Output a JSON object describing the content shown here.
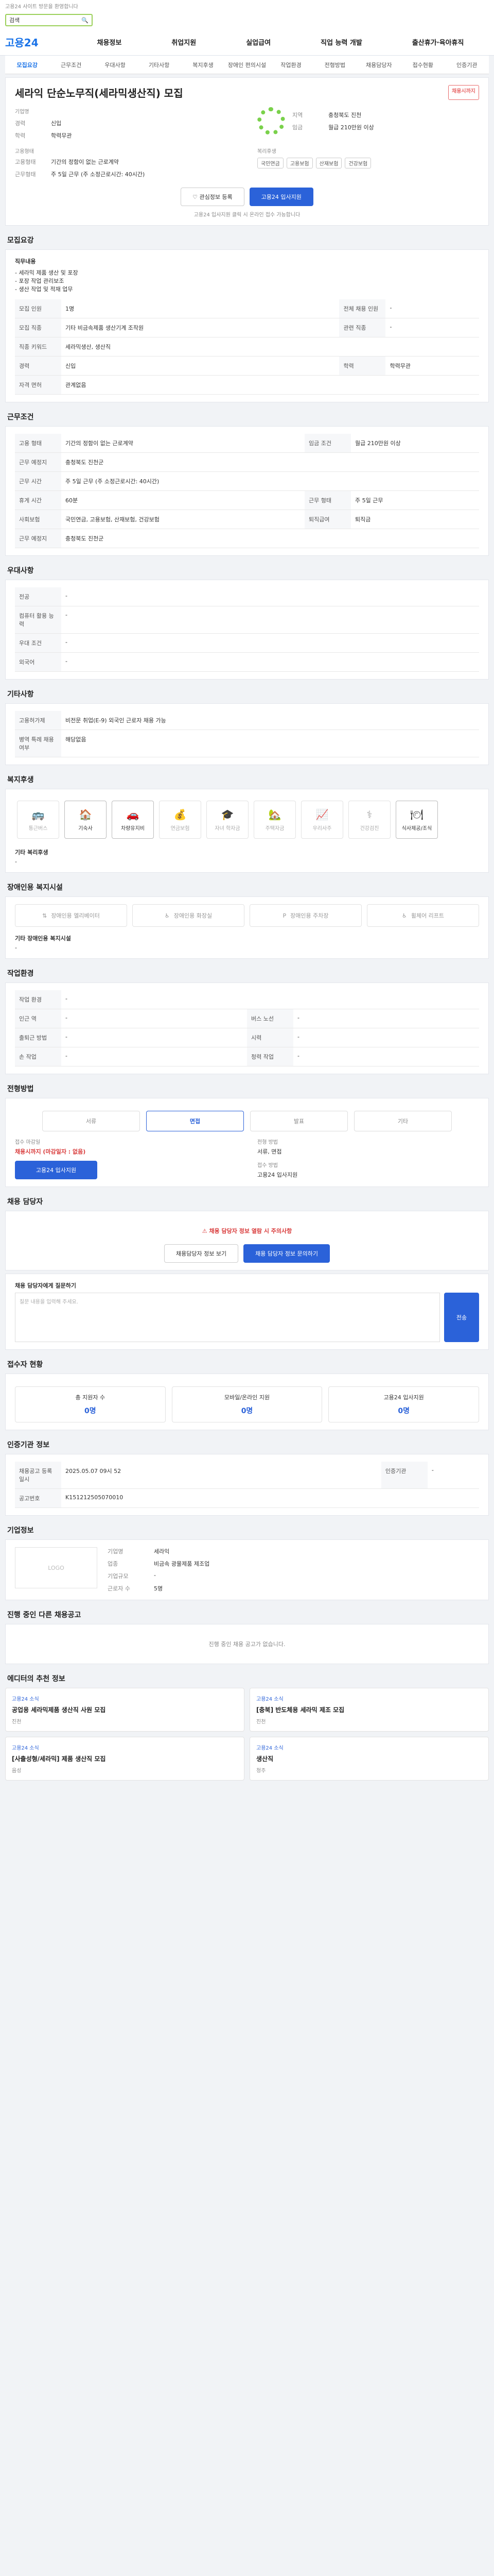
{
  "top_note": "고용24 사이트 방문을 환영합니다",
  "search": {
    "value": "검색"
  },
  "logo": "고용24",
  "gnb": [
    "채용정보",
    "취업지원",
    "실업급여",
    "직업 능력 개발",
    "출산휴가·육아휴직"
  ],
  "tabs": [
    "모집요강",
    "근무조건",
    "우대사항",
    "기타사항",
    "복지후생",
    "장애인 편의시설",
    "작업환경",
    "전형방법",
    "채용담당자",
    "접수현황",
    "인증기관"
  ],
  "job": {
    "company_label": "기업명",
    "title": "세라익 단순노무직(세라믹생산직) 모집",
    "badge": "채용시까지",
    "fields": [
      {
        "k": "경력",
        "v": "신입"
      },
      {
        "k": "학력",
        "v": "학력무관"
      }
    ],
    "fields2": [
      {
        "k": "지역",
        "v": "충청북도 진천"
      },
      {
        "k": "임금",
        "v": "월급 210만원 이상"
      }
    ],
    "cond_label": "고용형태",
    "cond": [
      {
        "k": "고용형태",
        "v": "기간의 정함이 없는 근로계약"
      },
      {
        "k": "근무형태",
        "v": "주 5일 근무 (주 소정근로시간: 40시간)"
      }
    ],
    "benefit_label": "복리후생",
    "benefits": [
      "국민연금",
      "고용보험",
      "산재보험",
      "건강보험"
    ]
  },
  "buttons": {
    "scrap": "관심정보 등록",
    "apply": "고용24 입사지원"
  },
  "apply_note": "고용24 입사지원 클릭 시 온라인 접수 가능합니다",
  "sections": {
    "recruit": "모집요강",
    "work": "근무조건",
    "pref": "우대사항",
    "etc": "기타사항",
    "welfare": "복지후생",
    "disabled": "장애인용 복지시설",
    "env": "작업환경",
    "screen": "전형방법",
    "manager": "채용 담당자",
    "status": "접수자 현황",
    "cert": "인증기관 정보",
    "company": "기업정보",
    "other": "진행 중인 다른 채용공고",
    "recommend": "에디터의 추천 정보"
  },
  "recruit_duty": "직무내용",
  "recruit_duties": [
    "- 세라믹 제품 생산 및 포장",
    "- 포장 작업 관리보조",
    "- 생산 작업 및 적재 업무"
  ],
  "recruit_rows": [
    [
      "모집 인원",
      "1명",
      "전체 채용 인원",
      "-"
    ],
    [
      "모집 직종",
      "기타 비금속제품 생산기계 조작원",
      "관련 직종",
      "-"
    ],
    [
      "직종 키워드",
      "세라믹생산, 생산직",
      "",
      ""
    ],
    [
      "경력",
      "신입",
      "학력",
      "학력무관"
    ],
    [
      "자격 면허",
      "관계없음",
      "",
      ""
    ]
  ],
  "work_rows": [
    [
      "고용 형태",
      "기간의 정함이 없는 근로계약",
      "임금 조건",
      "월급 210만원 이상"
    ],
    [
      "근무 예정지",
      "충청북도 진천군",
      "",
      ""
    ],
    [
      "근무 시간",
      "주 5일 근무 (주 소정근로시간: 40시간)",
      "",
      ""
    ],
    [
      "휴게 시간",
      "60분",
      "근무 형태",
      "주 5일 근무"
    ],
    [
      "사회보험",
      "국민연금, 고용보험, 산재보험, 건강보험",
      "퇴직급여",
      "퇴직금"
    ],
    [
      "근무 예정지",
      "충청북도 진천군",
      "",
      ""
    ]
  ],
  "pref_rows": [
    [
      "전공",
      "-"
    ],
    [
      "컴퓨터 활용 능력",
      "-"
    ],
    [
      "우대 조건",
      "-"
    ],
    [
      "외국어",
      "-"
    ]
  ],
  "etc_rows": [
    [
      "고용허가제",
      "비전문 취업(E-9) 외국인 근로자 채용 가능"
    ],
    [
      "병역 특례 채용 여부",
      "해당없음"
    ]
  ],
  "welfare_items": [
    "통근버스",
    "기숙사",
    "차량유지비",
    "연금보험",
    "자녀 학자금",
    "주택자금",
    "우리사주",
    "건강검진",
    "식사제공/조식"
  ],
  "welfare_etc": "기타 복리후생",
  "disabled_items": [
    "장애인용 엘리베이터",
    "장애인용 화장실",
    "장애인용 주차장",
    "휠체어 리프트"
  ],
  "disabled_etc": "기타 장애인용 복지시설",
  "env_rows": [
    [
      "작업 환경",
      "-"
    ],
    [
      "인근 역",
      "-",
      "버스 노선",
      "-"
    ],
    [
      "출퇴근 방법",
      "-",
      "시력",
      "-"
    ],
    [
      "손 작업",
      "-",
      "청력 작업",
      "-"
    ]
  ],
  "steps": [
    "서류",
    "면접",
    "발표",
    "기타"
  ],
  "screen_info": [
    {
      "k": "접수 마감일",
      "v": "채용시까지 (마감일자 : 없음)"
    },
    {
      "k": "전형 방법",
      "v": "서류, 면접"
    },
    {
      "k": "접수 방법",
      "v": "고용24 입사지원"
    }
  ],
  "screen_btn": "고용24 입사지원",
  "manager_alert": "채용 담당자 정보 열람 시 주의사항",
  "manager_btn1": "채용담당자 정보 보기",
  "manager_btn2": "채용 담당자 정보 문의하기",
  "inquiry_label": "채용 담당자에게 질문하기",
  "inquiry_placeholder": "질문 내용을 입력해 주세요.",
  "inquiry_btn": "전송",
  "stats": [
    {
      "k": "총 지원자 수",
      "v": "0명"
    },
    {
      "k": "모바일/온라인 지원",
      "v": "0명"
    },
    {
      "k": "고용24 입사지원",
      "v": "0명"
    }
  ],
  "cert_rows": [
    [
      "채용공고 등록일시",
      "2025.05.07 09시 52",
      "인증기관",
      "-"
    ],
    [
      "공고번호",
      "K151212505070010"
    ]
  ],
  "company_info": [
    [
      "기업명",
      "세라익"
    ],
    [
      "업종",
      "비금속 광물제품 제조업"
    ],
    [
      "기업규모",
      "-"
    ],
    [
      "근로자 수",
      "5명"
    ]
  ],
  "other_msg": "진행 중인 채용 공고가 없습니다.",
  "recommends": [
    {
      "cat": "고용24 소식",
      "title": "공업용 세라믹제품 생산직 사원 모집",
      "loc": "진천"
    },
    {
      "cat": "고용24 소식",
      "title": "[충북] 반도체용 세라믹 제조 모집",
      "loc": "진천"
    },
    {
      "cat": "고용24 소식",
      "title": "[사출성형/세라믹] 제품 생산직 모집",
      "loc": "음성"
    },
    {
      "cat": "고용24 소식",
      "title": "생산직",
      "loc": "청주"
    }
  ]
}
